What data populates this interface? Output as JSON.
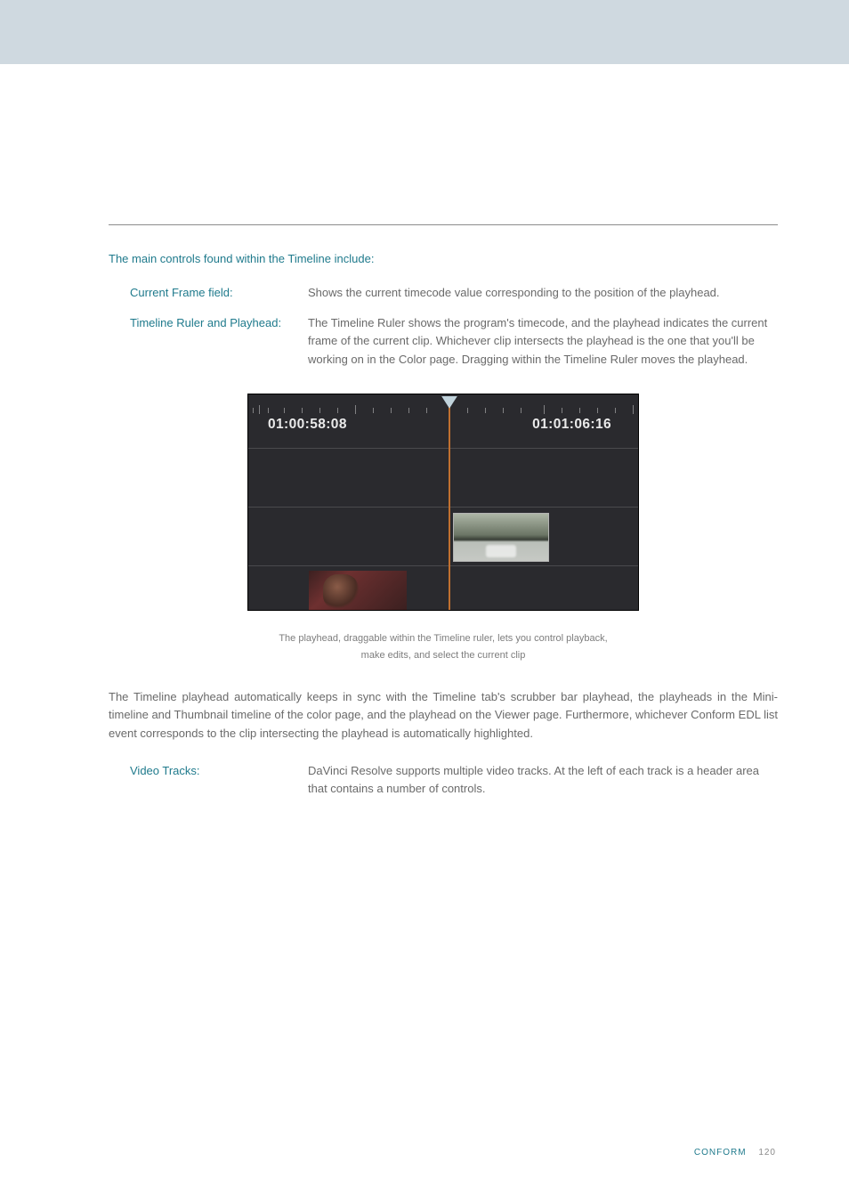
{
  "intro": "The main controls found within the Timeline include:",
  "items": [
    {
      "term": "Current Frame field:",
      "desc": "Shows the current timecode value corresponding to the position of the playhead."
    },
    {
      "term": "Timeline Ruler and Playhead:",
      "desc": "The Timeline Ruler shows the program's timecode, and the playhead indicates the current frame of the current clip. Whichever clip intersects the playhead is the one that you'll be working on in the Color page. Dragging within the Timeline Ruler moves the playhead."
    }
  ],
  "figure": {
    "timecode_left": "01:00:58:08",
    "timecode_right": "01:01:06:16"
  },
  "caption_line1": "The playhead, draggable within the Timeline ruler, lets you control playback,",
  "caption_line2": "make edits, and select the current clip",
  "paragraph": "The Timeline playhead automatically keeps in sync with the Timeline tab's scrubber bar playhead, the playheads in the Mini-timeline and Thumbnail timeline of the color page, and the playhead on the Viewer page. Furthermore, whichever Conform EDL list event corresponds to the clip intersecting the playhead is automatically highlighted.",
  "items2": [
    {
      "term": "Video Tracks:",
      "desc": "DaVinci Resolve supports multiple video tracks. At the left of each track is a header area that contains a number of controls."
    }
  ],
  "footer": {
    "section": "CONFORM",
    "page": "120"
  }
}
